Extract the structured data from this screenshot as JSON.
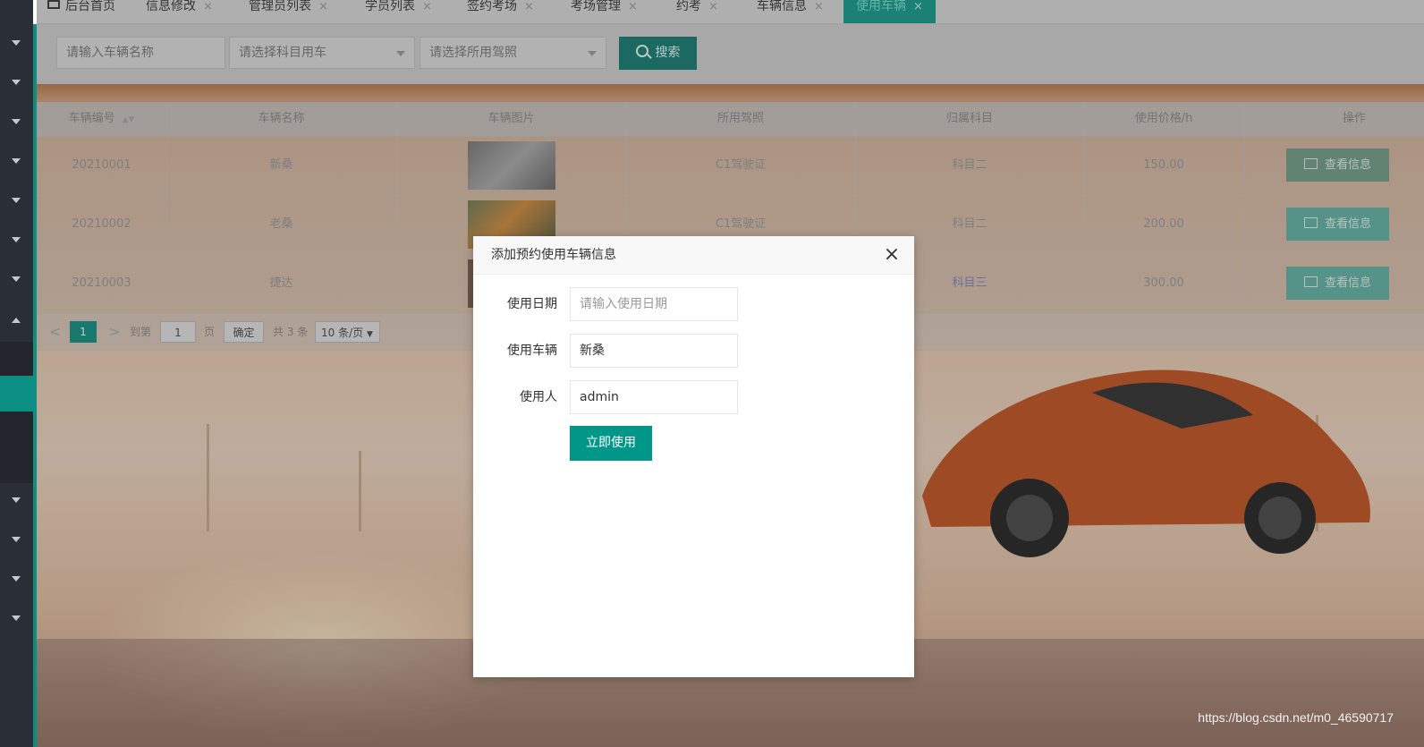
{
  "tabs": [
    {
      "label": "后台首页",
      "closable": false,
      "icon": "monitor-icon"
    },
    {
      "label": "信息修改",
      "closable": true
    },
    {
      "label": "管理员列表",
      "closable": true
    },
    {
      "label": "学员列表",
      "closable": true
    },
    {
      "label": "签约考场",
      "closable": true
    },
    {
      "label": "考场管理",
      "closable": true
    },
    {
      "label": "约考",
      "closable": true
    },
    {
      "label": "车辆信息",
      "closable": true
    },
    {
      "label": "使用车辆",
      "closable": true,
      "active": true
    }
  ],
  "tab_close_glyph": "×",
  "toolbar": {
    "name_placeholder": "请输入车辆名称",
    "subject_placeholder": "请选择科目用车",
    "license_placeholder": "请选择所用驾照",
    "search_label": "搜索"
  },
  "table": {
    "headers": [
      "车辆编号",
      "车辆名称",
      "车辆图片",
      "所用驾照",
      "归属科目",
      "使用价格/h",
      "操作"
    ],
    "rows": [
      {
        "id": "20210001",
        "name": "新桑",
        "license": "C1驾驶证",
        "subject": "科目二",
        "price": "150.00",
        "action": "查看信息"
      },
      {
        "id": "20210002",
        "name": "老桑",
        "license": "C1驾驶证",
        "subject": "科目二",
        "price": "200.00",
        "action": "查看信息"
      },
      {
        "id": "20210003",
        "name": "捷达",
        "license": "",
        "subject": "科目三",
        "price": "300.00",
        "action": "查看信息"
      }
    ]
  },
  "pager": {
    "prev": "<",
    "current": "1",
    "next": ">",
    "goto_label": "到第",
    "goto_value": "1",
    "page_unit": "页",
    "confirm": "确定",
    "total": "共 3 条",
    "page_size": "10 条/页"
  },
  "modal": {
    "title": "添加预约使用车辆信息",
    "close": "×",
    "date_label": "使用日期",
    "date_placeholder": "请输入使用日期",
    "vehicle_label": "使用车辆",
    "vehicle_value": "新桑",
    "user_label": "使用人",
    "user_value": "admin",
    "submit": "立即使用"
  },
  "watermark": "https://blog.csdn.net/m0_46590717",
  "colors": {
    "accent": "#009688",
    "sidebar": "#2a2f37",
    "active_tab": "#0f9a8c"
  }
}
